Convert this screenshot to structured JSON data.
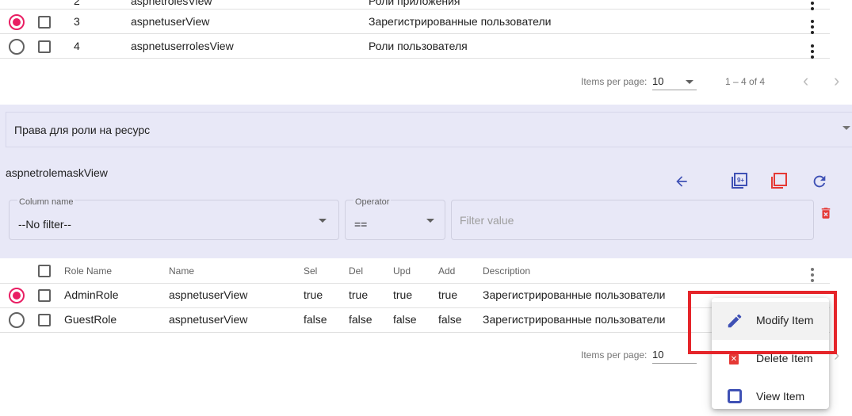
{
  "top_table": {
    "partial_row": {
      "num": "2",
      "name": "aspnetrolesView",
      "desc": "Роли приложения"
    },
    "rows": [
      {
        "selected": true,
        "num": "3",
        "name": "aspnetuserView",
        "desc": "Зарегистрированные пользователи"
      },
      {
        "selected": false,
        "num": "4",
        "name": "aspnetuserrolesView",
        "desc": "Роли пользователя"
      }
    ],
    "paginator": {
      "items_label": "Items per page:",
      "page_size": "10",
      "range": "1 – 4 of 4"
    }
  },
  "expander": {
    "title": "Права для роли на ресурс"
  },
  "view_title": "aspnetrolemaskView",
  "filter": {
    "column_label": "Column name",
    "column_value": "--No filter--",
    "operator_label": "Operator",
    "operator_value": "==",
    "value_placeholder": "Filter value"
  },
  "toolbar_icons": [
    "arrow-back-icon",
    "add-multiple-icon",
    "copy-icon",
    "refresh-icon",
    "delete-filter-icon"
  ],
  "colors": {
    "accent": "#3f51b5",
    "pink": "#e91e63",
    "red": "#e53935",
    "panel": "#e8e8f7"
  },
  "bottom_table": {
    "headers": {
      "role": "Role Name",
      "name": "Name",
      "sel": "Sel",
      "del": "Del",
      "upd": "Upd",
      "add": "Add",
      "desc": "Description"
    },
    "rows": [
      {
        "selected": true,
        "role": "AdminRole",
        "name": "aspnetuserView",
        "sel": "true",
        "del": "true",
        "upd": "true",
        "add": "true",
        "desc": "Зарегистрированные пользователи"
      },
      {
        "selected": false,
        "role": "GuestRole",
        "name": "aspnetuserView",
        "sel": "false",
        "del": "false",
        "upd": "false",
        "add": "false",
        "desc": "Зарегистрированные пользователи"
      }
    ],
    "paginator": {
      "items_label": "Items per page:",
      "page_size": "10"
    }
  },
  "context_menu": {
    "items": [
      {
        "label": "Modify Item",
        "icon": "pencil-icon"
      },
      {
        "label": "Delete Item",
        "icon": "delete-box-icon"
      },
      {
        "label": "View Item",
        "icon": "view-icon"
      }
    ]
  }
}
